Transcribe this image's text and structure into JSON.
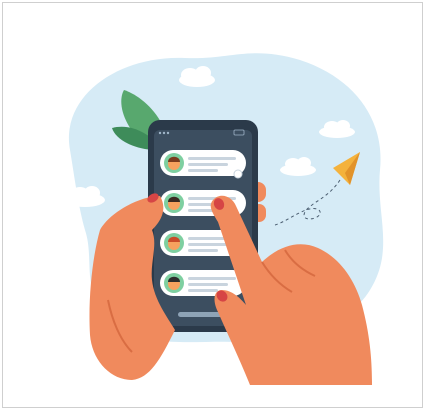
{
  "illustration": {
    "subject": "hands-holding-smartphone-chat-list",
    "colors": {
      "blob": "#d6ebf6",
      "cloud": "#ffffff",
      "phone_body": "#2b3a4a",
      "phone_screen": "#3c4e60",
      "bubble": "#ffffff",
      "skin": "#f08a5d",
      "skin_shadow": "#d96d43",
      "nail": "#d64545",
      "leaf_dark": "#3e8c5a",
      "leaf_light": "#58a86e",
      "plane": "#f4b23c",
      "plane_shade": "#e2932a",
      "accent_lines": "#4a5d70"
    },
    "chat_items": [
      {
        "avatar_color": "#f6a25f",
        "hair": "#7a3b1e"
      },
      {
        "avatar_color": "#f6a25f",
        "hair": "#3a2a22"
      },
      {
        "avatar_color": "#f6a25f",
        "hair": "#c94c2a"
      },
      {
        "avatar_color": "#f6a25f",
        "hair": "#2d2d2d"
      }
    ]
  }
}
